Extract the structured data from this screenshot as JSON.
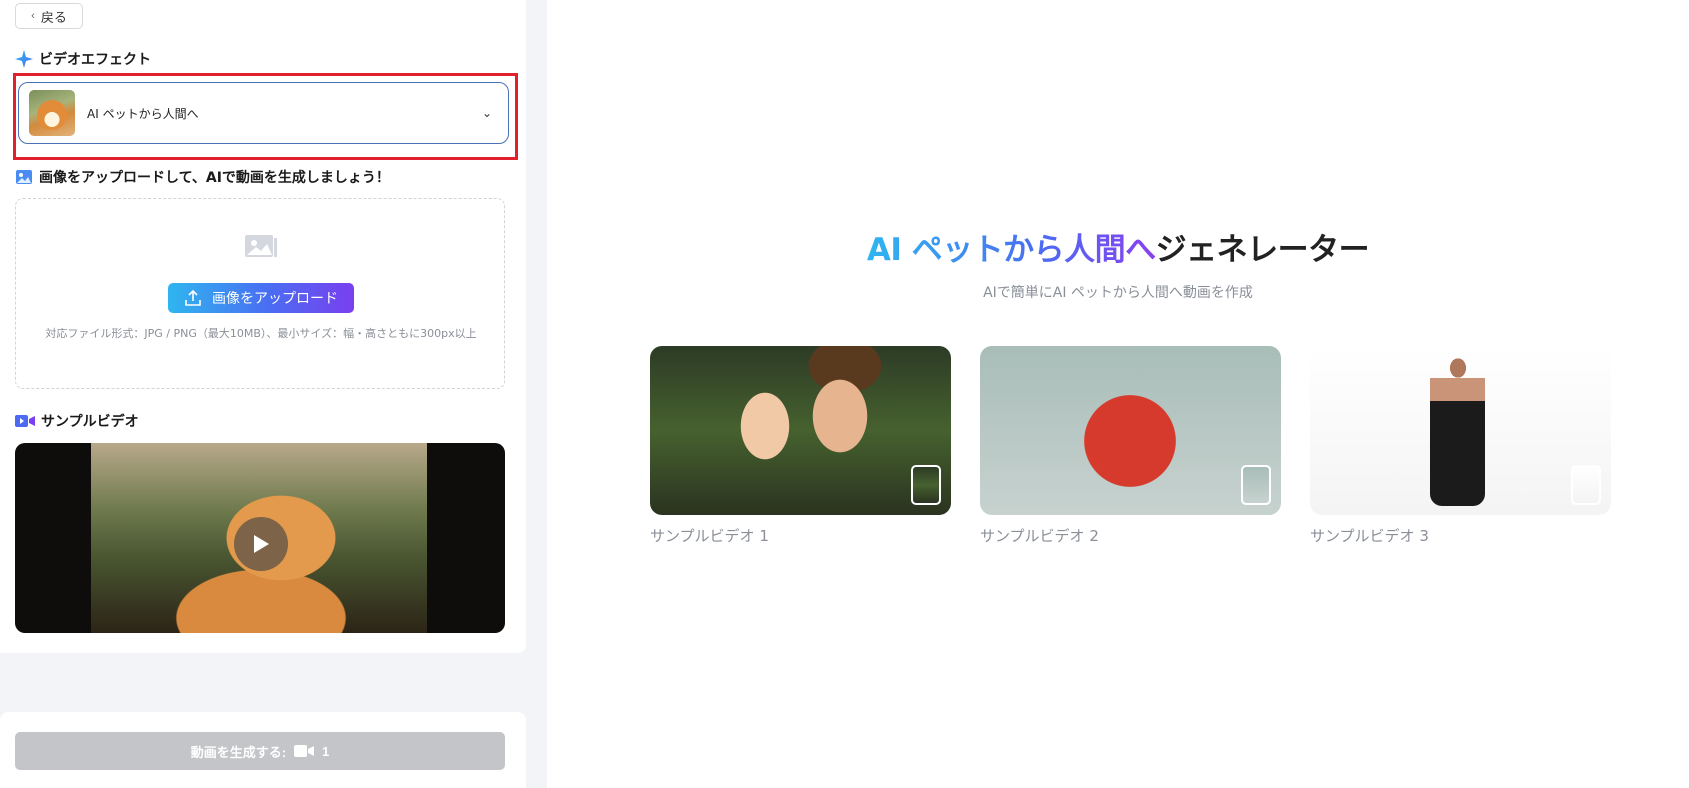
{
  "sidebar": {
    "back_label": "戻る",
    "effect_section_title": "ビデオエフェクト",
    "selected_effect": "AI ペットから人間へ",
    "upload_section_title": "画像をアップロードして、AIで動画を生成しましょう！",
    "upload_button": "画像をアップロード",
    "upload_hint": "対応ファイル形式：JPG / PNG（最大10MB）、最小サイズ：幅・高さともに300px以上",
    "sample_section_title": "サンプルビデオ",
    "generate_button": "動画を生成する:",
    "generate_cost": "1"
  },
  "main": {
    "title_highlight": "AI ペットから人間へ",
    "title_rest": "ジェネレーター",
    "subtitle": "AIで簡単にAI ペットから人間へ動画を作成",
    "samples": [
      {
        "caption": "サンプルビデオ 1"
      },
      {
        "caption": "サンプルビデオ 2"
      },
      {
        "caption": "サンプルビデオ 3"
      }
    ]
  },
  "colors": {
    "highlight_border": "#e0202c",
    "accent_start": "#2fb6f0",
    "accent_end": "#7a3ff0",
    "disabled_button": "#c4c5c9"
  },
  "icons": [
    "chevron-left-icon",
    "sparkle-icon",
    "chevron-down-icon",
    "image-icon",
    "upload-icon",
    "video-camera-icon",
    "play-icon"
  ]
}
